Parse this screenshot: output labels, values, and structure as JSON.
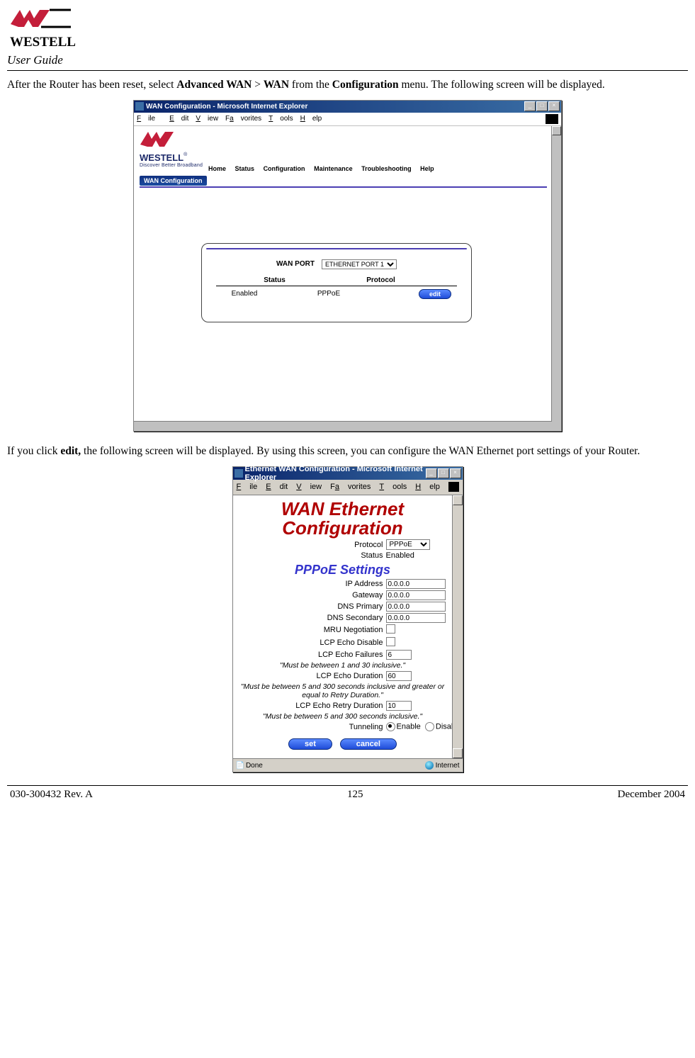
{
  "page_header": {
    "brand_letter": "W",
    "brand_name": "WESTELL",
    "doc_title": "User Guide"
  },
  "para1": {
    "pre": "After the Router has been reset, select ",
    "b1": "Advanced WAN",
    "mid1": " > ",
    "b2": "WAN",
    "mid2": " from the ",
    "b3": "Configuration",
    "post": " menu. The following screen will be displayed."
  },
  "fig1": {
    "title": "WAN Configuration - Microsoft Internet Explorer",
    "menu": {
      "file": "File",
      "edit": "Edit",
      "view": "View",
      "favorites": "Favorites",
      "tools": "Tools",
      "help": "Help"
    },
    "logo_brand": "WESTELL",
    "logo_trade": "®",
    "logo_tag": "Discover Better Broadband",
    "nav": {
      "home": "Home",
      "status": "Status",
      "config": "Configuration",
      "maint": "Maintenance",
      "trouble": "Troubleshooting",
      "help": "Help"
    },
    "chip": "WAN Configuration",
    "panel": {
      "wan_port_label": "WAN PORT",
      "wan_port_value": "ETHERNET PORT 1",
      "col_status": "Status",
      "col_protocol": "Protocol",
      "row_status": "Enabled",
      "row_protocol": "PPPoE",
      "edit_btn": "edit"
    }
  },
  "para2": {
    "pre": "If you click ",
    "b1": "edit,",
    "post": " the following screen will be displayed. By using this screen, you can configure the WAN Ethernet port settings of your Router."
  },
  "fig2": {
    "title": "Ethernet WAN Configuration - Microsoft Internet Explorer",
    "menu": {
      "file": "File",
      "edit": "Edit",
      "view": "View",
      "favorites": "Favorites",
      "tools": "Tools",
      "help": "Help"
    },
    "h1_line1": "WAN Ethernet",
    "h1_line2": "Configuration",
    "protocol_label": "Protocol",
    "protocol_value": "PPPoE",
    "status_label": "Status",
    "status_value": "Enabled",
    "h2": "PPPoE Settings",
    "ip_label": "IP Address",
    "ip_value": "0.0.0.0",
    "gw_label": "Gateway",
    "gw_value": "0.0.0.0",
    "dns1_label": "DNS Primary",
    "dns1_value": "0.0.0.0",
    "dns2_label": "DNS Secondary",
    "dns2_value": "0.0.0.0",
    "mru_label": "MRU Negotiation",
    "lcp_dis_label": "LCP Echo Disable",
    "lcp_fail_label": "LCP Echo Failures",
    "lcp_fail_value": "6",
    "lcp_fail_note": "\"Must be between 1 and 30 inclusive.\"",
    "lcp_dur_label": "LCP Echo Duration",
    "lcp_dur_value": "60",
    "lcp_dur_note": "\"Must be between 5 and 300 seconds inclusive and greater or equal to Retry Duration.\"",
    "lcp_retry_label": "LCP Echo Retry Duration",
    "lcp_retry_value": "10",
    "lcp_retry_note": "\"Must be between 5 and 300 seconds inclusive.\"",
    "tunneling_label": "Tunneling",
    "tunneling_enable": "Enable",
    "tunneling_disable": "Disable",
    "set_btn": "set",
    "cancel_btn": "cancel",
    "status_done": "Done",
    "status_zone": "Internet"
  },
  "footer": {
    "left": "030-300432 Rev. A",
    "center": "125",
    "right": "December 2004"
  }
}
